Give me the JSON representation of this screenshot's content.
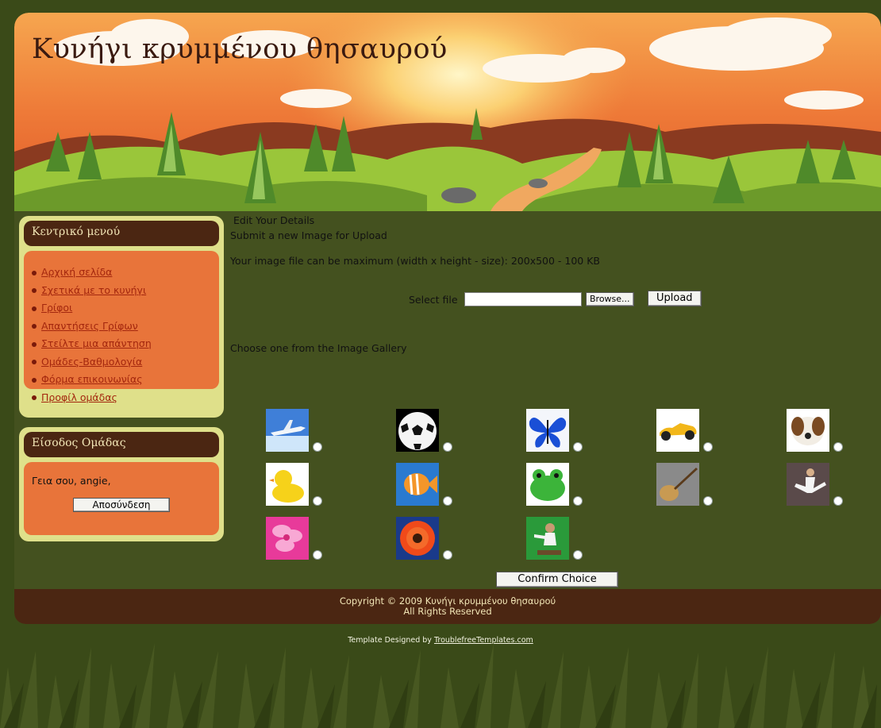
{
  "header": {
    "title": "Κυνήγι κρυμμένου θησαυρού"
  },
  "sidebar": {
    "menu_title": "Κεντρικό μενού",
    "menu_items": [
      "Αρχική σελίδα",
      "Σχετικά με το κυνήγι",
      "Γρίφοι",
      "Απαντήσεις Γρίφων",
      "Στείλτε μια απάντηση",
      "Ομάδες-Βαθμολογία",
      "Φόρμα επικοινωνίας",
      "Προφίλ ομάδας"
    ],
    "login_title": "Είσοδος Ομάδας",
    "greeting": "Γεια σου, angie,",
    "logout_label": "Αποσύνδεση"
  },
  "main": {
    "edit_details": "Edit Your Details",
    "submit_new": "Submit a new Image for Upload",
    "max_info": "Your image file can be maximum (width x height - size): 200x500 - 100 KB",
    "select_label": "Select file",
    "file_value": "",
    "browse_label": "Browse...",
    "upload_label": "Upload",
    "choose_label": "Choose one from the Image Gallery",
    "gallery": [
      {
        "name": "airplane"
      },
      {
        "name": "soccer-ball"
      },
      {
        "name": "butterfly"
      },
      {
        "name": "race-car"
      },
      {
        "name": "dog"
      },
      {
        "name": "duck"
      },
      {
        "name": "fish"
      },
      {
        "name": "frog"
      },
      {
        "name": "guitar"
      },
      {
        "name": "karate"
      },
      {
        "name": "pink-flower"
      },
      {
        "name": "orange-flower"
      },
      {
        "name": "skateboarder"
      }
    ],
    "confirm_label": "Confirm Choice"
  },
  "footer": {
    "copyright_line1": "Copyright © 2009 Κυνήγι κρυμμένου θησαυρού",
    "copyright_line2": "All Rights Reserved",
    "credit_prefix": "Template Designed by ",
    "credit_link": "TroublefreeTemplates.com"
  },
  "colors": {
    "background": "#3a4a18",
    "content_bg": "#44511f",
    "sidebar_frame": "#dfe08a",
    "sidebar_header": "#4b2612",
    "sidebar_body": "#e8743a",
    "footer_bg": "#4b2612"
  }
}
